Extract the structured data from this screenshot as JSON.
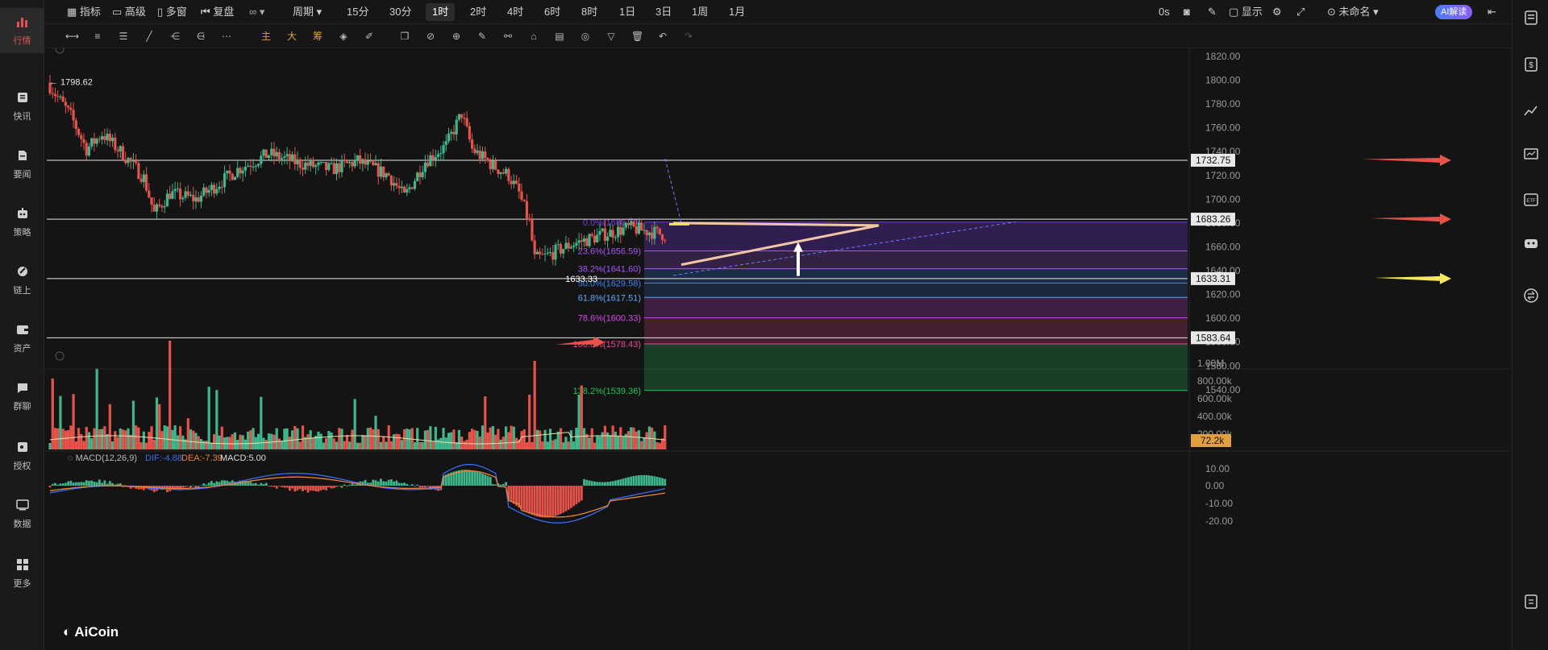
{
  "sidebar": {
    "items": [
      {
        "label": "行情",
        "icon": "chart-bars-icon",
        "active": true
      },
      {
        "label": "快讯",
        "icon": "newsflash-icon"
      },
      {
        "label": "要闻",
        "icon": "news-icon"
      },
      {
        "label": "策略",
        "icon": "robot-icon"
      },
      {
        "label": "链上",
        "icon": "onchain-icon"
      },
      {
        "label": "资产",
        "icon": "wallet-icon"
      },
      {
        "label": "群聊",
        "icon": "chat-icon"
      },
      {
        "label": "授权",
        "icon": "key-icon"
      },
      {
        "label": "数据",
        "icon": "data-icon"
      },
      {
        "label": "更多",
        "icon": "more-grid-icon"
      }
    ]
  },
  "toolbar": {
    "indicator": "指标",
    "advanced": "高级",
    "multiwindow": "多窗",
    "replay": "复盘",
    "period": "周期",
    "intervals": [
      "15分",
      "30分",
      "1时",
      "2时",
      "4时",
      "6时",
      "8时",
      "1日",
      "3日",
      "1周",
      "1月"
    ],
    "selected_interval": "1时",
    "timer": "0s",
    "display": "显示",
    "layout_name": "未命名",
    "ai_button": "AI解读"
  },
  "drawbar": {
    "labels": {
      "main": "主",
      "big": "大",
      "fib": "筹"
    }
  },
  "chart": {
    "high_marker": "1798.62",
    "low_marker": "1633.33",
    "price_axis": [
      "1820.00",
      "1800.00",
      "1780.00",
      "1760.00",
      "1740.00",
      "1720.00",
      "1700.00",
      "1680.00",
      "1660.00",
      "1640.00",
      "1620.00",
      "1600.00",
      "1580.00",
      "1560.00",
      "1540.00"
    ],
    "price_tags": [
      {
        "text": "1732.75",
        "price": 1732.75
      },
      {
        "text": "1683.26",
        "price": 1683.26
      },
      {
        "text": "1633.31",
        "price": 1633.31
      },
      {
        "text": "1583.64",
        "price": 1583.64
      }
    ],
    "fib_levels": [
      {
        "label": "0.0%(1680.79)",
        "price": 1680.79,
        "color": "#7c3aed"
      },
      {
        "label": "23.6%(1656.59)",
        "price": 1656.59,
        "color": "#a855f7"
      },
      {
        "label": "38.2%(1641.60)",
        "price": 1641.6,
        "color": "#a855f7"
      },
      {
        "label": "50.0%(1629.58)",
        "price": 1629.58,
        "color": "#3b82f6"
      },
      {
        "label": "61.8%(1617.51)",
        "price": 1617.51,
        "color": "#60a5fa"
      },
      {
        "label": "78.6%(1600.33)",
        "price": 1600.33,
        "color": "#d946ef"
      },
      {
        "label": "100.0%(1578.43)",
        "price": 1578.43,
        "color": "#ec4899"
      },
      {
        "label": "138.2%(1539.36)",
        "price": 1539.36,
        "color": "#22c55e"
      }
    ],
    "volume_axis": [
      "1.00M",
      "800.00k",
      "600.00k",
      "400.00k",
      "200.00k"
    ],
    "volume_tag": "72.2k",
    "macd_axis": [
      "10.00",
      "0.00",
      "-10.00",
      "-20.00"
    ],
    "macd_legend": {
      "name": "MACD(12,26,9)",
      "dif": "DIF:-4.88",
      "dea": "DEA:-7.39",
      "macd": "MACD:5.00"
    },
    "logo": "AiCoin"
  },
  "colors": {
    "up": "#3fb68b",
    "down": "#e5534b",
    "accent": "#e05252"
  }
}
